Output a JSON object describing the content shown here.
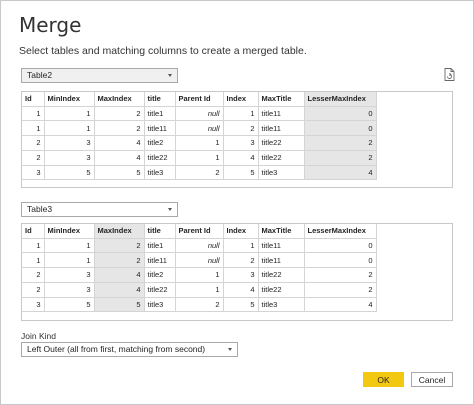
{
  "dialog": {
    "title": "Merge",
    "subtitle": "Select tables and matching columns to create a merged table."
  },
  "table1": {
    "selector": "Table2",
    "columns": [
      "Id",
      "MinIndex",
      "MaxIndex",
      "title",
      "Parent Id",
      "Index",
      "MaxTitle",
      "LesserMaxIndex"
    ],
    "selected_column": "LesserMaxIndex",
    "rows": [
      [
        "1",
        "1",
        "2",
        "title1",
        "null",
        "1",
        "title11",
        "0"
      ],
      [
        "1",
        "1",
        "2",
        "title11",
        "null",
        "2",
        "title11",
        "0"
      ],
      [
        "2",
        "3",
        "4",
        "title2",
        "1",
        "3",
        "title22",
        "2"
      ],
      [
        "2",
        "3",
        "4",
        "title22",
        "1",
        "4",
        "title22",
        "2"
      ],
      [
        "3",
        "5",
        "5",
        "title3",
        "2",
        "5",
        "title3",
        "4"
      ]
    ]
  },
  "table2": {
    "selector": "Table3",
    "columns": [
      "Id",
      "MinIndex",
      "MaxIndex",
      "title",
      "Parent Id",
      "Index",
      "MaxTitle",
      "LesserMaxIndex"
    ],
    "selected_column": "MaxIndex",
    "rows": [
      [
        "1",
        "1",
        "2",
        "title1",
        "null",
        "1",
        "title11",
        "0"
      ],
      [
        "1",
        "1",
        "2",
        "title11",
        "null",
        "2",
        "title11",
        "0"
      ],
      [
        "2",
        "3",
        "4",
        "title2",
        "1",
        "3",
        "title22",
        "2"
      ],
      [
        "2",
        "3",
        "4",
        "title22",
        "1",
        "4",
        "title22",
        "2"
      ],
      [
        "3",
        "5",
        "5",
        "title3",
        "2",
        "5",
        "title3",
        "4"
      ]
    ]
  },
  "join": {
    "label": "Join Kind",
    "selected": "Left Outer (all from first, matching from second)"
  },
  "buttons": {
    "ok": "OK",
    "cancel": "Cancel"
  },
  "icons": {
    "preview": "document-refresh-icon",
    "dropdown": "chevron-down-icon"
  },
  "colors": {
    "ok_button": "#f2c811",
    "selected_column": "#e6e6e6"
  }
}
